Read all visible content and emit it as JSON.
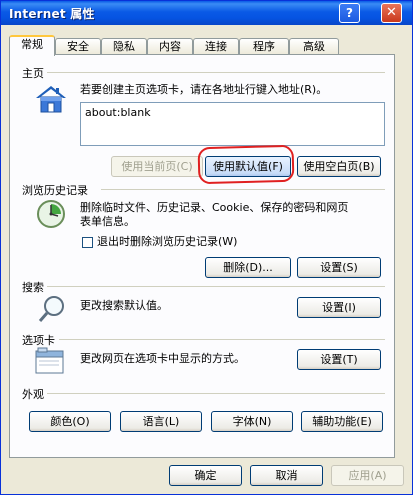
{
  "window": {
    "title": "Internet 属性",
    "help": "?",
    "close": "✕"
  },
  "tabs": [
    "常规",
    "安全",
    "隐私",
    "内容",
    "连接",
    "程序",
    "高级"
  ],
  "home": {
    "section": "主页",
    "desc": "若要创建主页选项卡，请在各地址行键入地址(R)。",
    "value": "about:blank",
    "use_current": "使用当前页(C)",
    "use_default": "使用默认值(F)",
    "use_blank": "使用空白页(B)",
    "icon": "house-icon"
  },
  "history": {
    "section": "浏览历史记录",
    "desc_line1": "删除临时文件、历史记录、Cookie、保存的密码和网页",
    "desc_line2": "表单信息。",
    "checkbox_label": "退出时删除浏览历史记录(W)",
    "delete": "删除(D)...",
    "settings": "设置(S)",
    "icon": "history-clock-icon"
  },
  "search": {
    "section": "搜索",
    "desc": "更改搜索默认值。",
    "settings": "设置(I)",
    "icon": "magnifier-icon"
  },
  "tabs_section": {
    "section": "选项卡",
    "desc": "更改网页在选项卡中显示的方式。",
    "settings": "设置(T)",
    "icon": "tabs-window-icon"
  },
  "appearance": {
    "section": "外观",
    "colors": "颜色(O)",
    "languages": "语言(L)",
    "fonts": "字体(N)",
    "accessibility": "辅助功能(E)"
  },
  "footer": {
    "ok": "确定",
    "cancel": "取消",
    "apply": "应用(A)"
  }
}
